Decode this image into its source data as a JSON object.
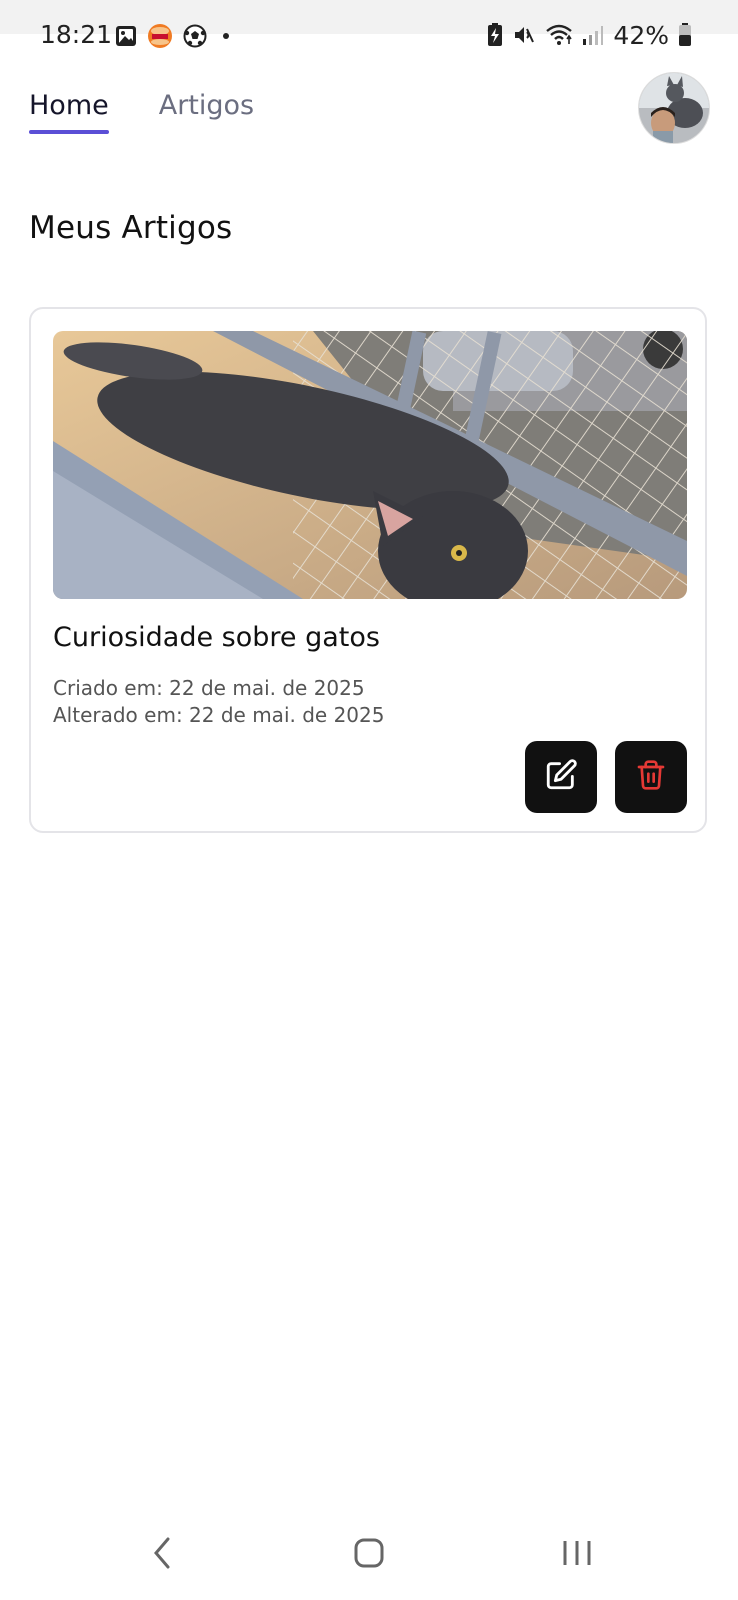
{
  "status_bar": {
    "time": "18:21",
    "battery": "42%",
    "left_icons": [
      "gallery-icon",
      "burger-king-icon",
      "soccer-ball-icon",
      "dot-icon"
    ],
    "right_icons": [
      "battery-saver-icon",
      "mute-icon",
      "wifi-icon",
      "signal-icon",
      "battery-icon"
    ]
  },
  "nav": {
    "tabs": [
      {
        "label": "Home",
        "active": true
      },
      {
        "label": "Artigos",
        "active": false
      }
    ],
    "avatar": "profile-avatar"
  },
  "page": {
    "title": "Meus Artigos"
  },
  "articles": [
    {
      "title": "Curiosidade sobre gatos",
      "created": "Criado em: 22 de mai. de 2025",
      "updated": "Alterado em: 22 de mai. de 2025",
      "image": "cat-photo",
      "actions": [
        "edit-icon",
        "trash-icon"
      ]
    }
  ],
  "colors": {
    "accent": "#5b4fd6",
    "button_bg": "#111111",
    "delete_icon": "#e53935",
    "edit_icon": "#ffffff"
  },
  "system_nav": [
    "back-icon",
    "home-icon",
    "recents-icon"
  ]
}
